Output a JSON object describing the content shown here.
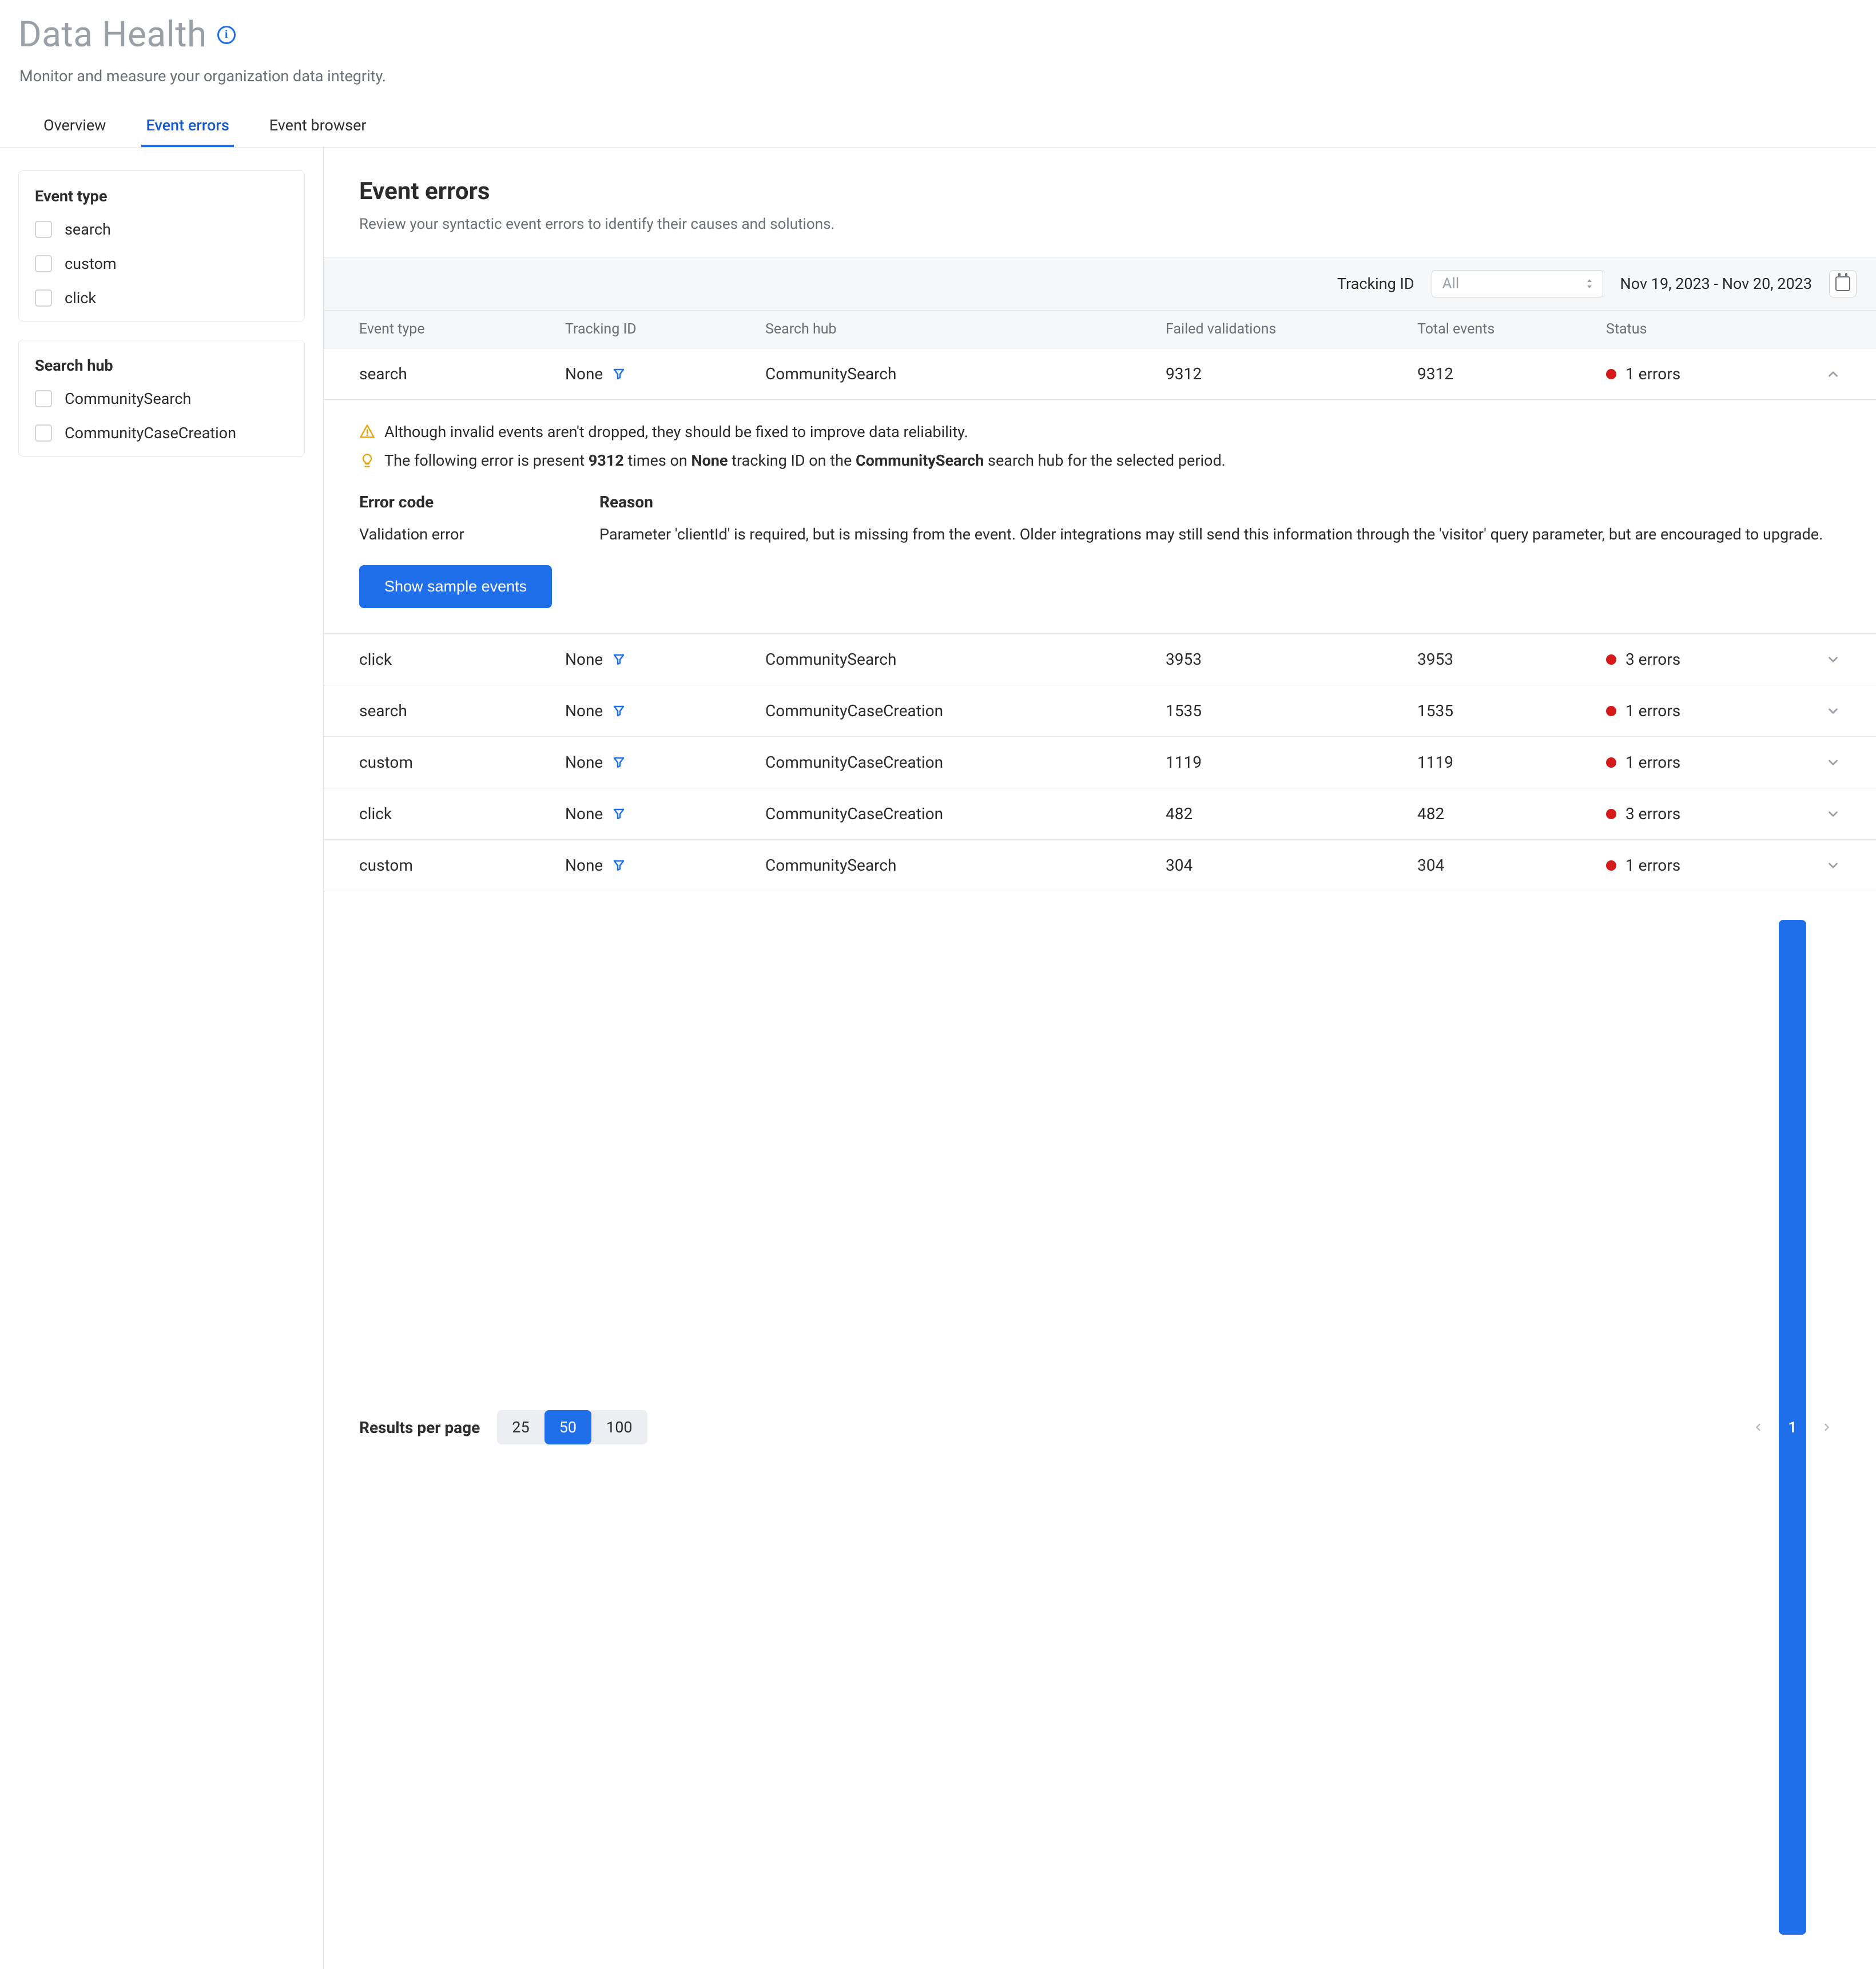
{
  "header": {
    "title": "Data Health",
    "subtitle": "Monitor and measure your organization data integrity.",
    "tabs": [
      {
        "label": "Overview",
        "active": false
      },
      {
        "label": "Event errors",
        "active": true
      },
      {
        "label": "Event browser",
        "active": false
      }
    ]
  },
  "sidebar": {
    "facets": [
      {
        "title": "Event type",
        "items": [
          "search",
          "custom",
          "click"
        ]
      },
      {
        "title": "Search hub",
        "items": [
          "CommunitySearch",
          "CommunityCaseCreation"
        ]
      }
    ]
  },
  "filterbar": {
    "tracking_id_label": "Tracking ID",
    "tracking_id_value": "All",
    "date_range": "Nov 19, 2023 - Nov 20, 2023"
  },
  "section": {
    "title": "Event errors",
    "desc": "Review your syntactic event errors to identify their causes and solutions."
  },
  "table": {
    "headers": [
      "Event type",
      "Tracking ID",
      "Search hub",
      "Failed validations",
      "Total events",
      "Status"
    ],
    "rows": [
      {
        "event_type": "search",
        "tracking_id": "None",
        "search_hub": "CommunitySearch",
        "failed": "9312",
        "total": "9312",
        "status": "1 errors",
        "expanded": true
      },
      {
        "event_type": "click",
        "tracking_id": "None",
        "search_hub": "CommunitySearch",
        "failed": "3953",
        "total": "3953",
        "status": "3 errors",
        "expanded": false
      },
      {
        "event_type": "search",
        "tracking_id": "None",
        "search_hub": "CommunityCaseCreation",
        "failed": "1535",
        "total": "1535",
        "status": "1 errors",
        "expanded": false
      },
      {
        "event_type": "custom",
        "tracking_id": "None",
        "search_hub": "CommunityCaseCreation",
        "failed": "1119",
        "total": "1119",
        "status": "1 errors",
        "expanded": false
      },
      {
        "event_type": "click",
        "tracking_id": "None",
        "search_hub": "CommunityCaseCreation",
        "failed": "482",
        "total": "482",
        "status": "3 errors",
        "expanded": false
      },
      {
        "event_type": "custom",
        "tracking_id": "None",
        "search_hub": "CommunitySearch",
        "failed": "304",
        "total": "304",
        "status": "1 errors",
        "expanded": false
      }
    ]
  },
  "detail": {
    "note1": "Although invalid events aren't dropped, they should be fixed to improve data reliability.",
    "note2_prefix": "The following error is present ",
    "note2_count": "9312",
    "note2_mid1": " times on ",
    "note2_tid": "None",
    "note2_mid2": " tracking ID on the ",
    "note2_hub": "CommunitySearch",
    "note2_suffix": " search hub for the selected period.",
    "error_code_h": "Error code",
    "error_code_v": "Validation error",
    "reason_h": "Reason",
    "reason_v": "Parameter 'clientId' is required, but is missing from the event. Older integrations may still send this information through the 'visitor' query parameter, but are encouraged to upgrade.",
    "show_btn": "Show sample events"
  },
  "footer": {
    "perpage_label": "Results per page",
    "options": [
      "25",
      "50",
      "100"
    ],
    "active_option": "50",
    "current_page": "1"
  },
  "colors": {
    "brand": "#1f6feb",
    "red": "#d41a1a"
  }
}
